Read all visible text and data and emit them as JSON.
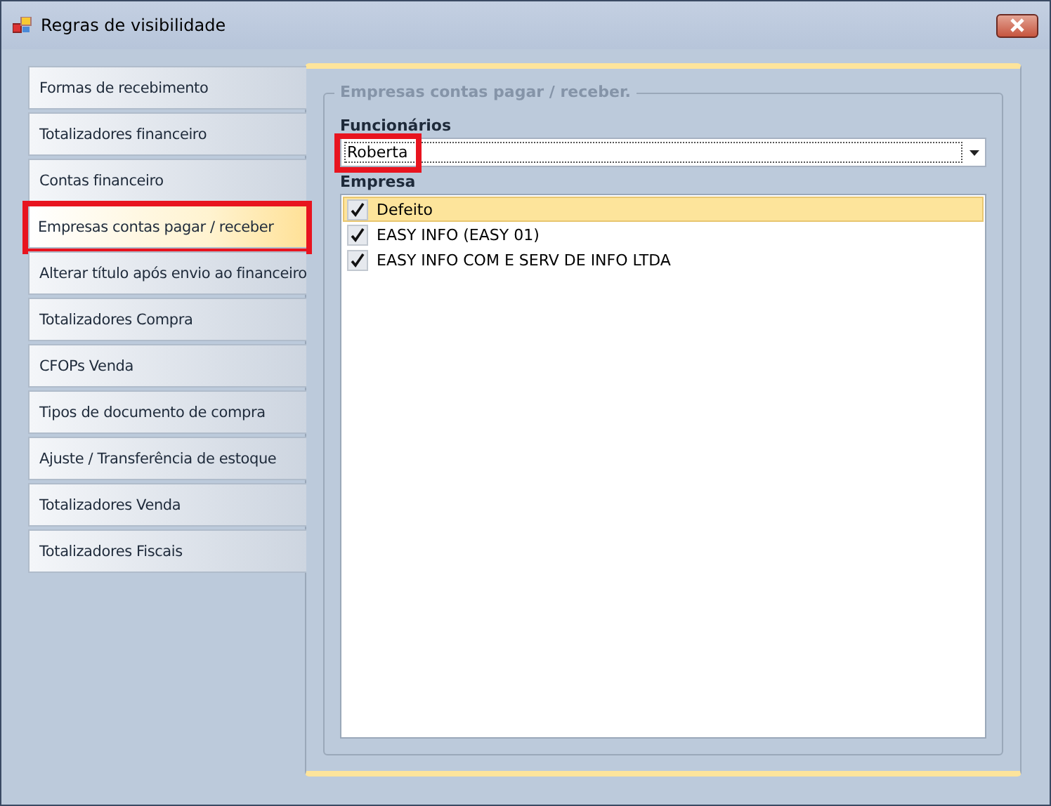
{
  "window": {
    "title": "Regras de visibilidade"
  },
  "tabs": [
    {
      "label": "Formas de recebimento",
      "selected": false,
      "highlighted": false
    },
    {
      "label": "Totalizadores financeiro",
      "selected": false,
      "highlighted": false
    },
    {
      "label": "Contas financeiro",
      "selected": false,
      "highlighted": false
    },
    {
      "label": "Empresas contas pagar / receber",
      "selected": true,
      "highlighted": true
    },
    {
      "label": "Alterar título após envio ao financeiro",
      "selected": false,
      "highlighted": false
    },
    {
      "label": "Totalizadores Compra",
      "selected": false,
      "highlighted": false
    },
    {
      "label": "CFOPs Venda",
      "selected": false,
      "highlighted": false
    },
    {
      "label": "Tipos de documento de compra",
      "selected": false,
      "highlighted": false
    },
    {
      "label": "Ajuste / Transferência de estoque",
      "selected": false,
      "highlighted": false
    },
    {
      "label": "Totalizadores Venda",
      "selected": false,
      "highlighted": false
    },
    {
      "label": "Totalizadores Fiscais",
      "selected": false,
      "highlighted": false
    }
  ],
  "group": {
    "title": "Empresas contas pagar / receber.",
    "employee": {
      "label": "Funcionários",
      "value": "Roberta",
      "highlighted": true
    },
    "companies": {
      "label": "Empresa",
      "items": [
        {
          "label": "Defeito",
          "checked": true,
          "selected": true
        },
        {
          "label": "EASY INFO (EASY 01)",
          "checked": true,
          "selected": false
        },
        {
          "label": "EASY INFO COM E SERV DE INFO LTDA",
          "checked": true,
          "selected": false
        }
      ]
    }
  }
}
